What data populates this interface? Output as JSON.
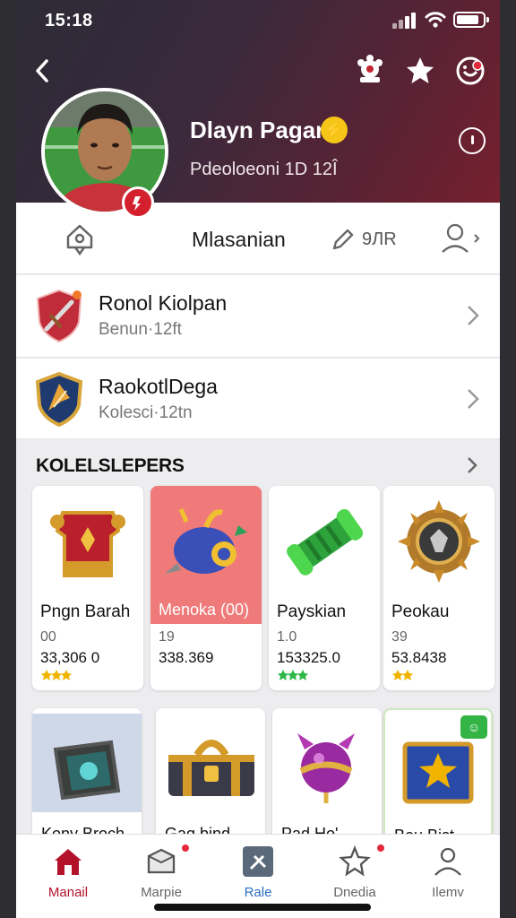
{
  "status": {
    "time": "15:18"
  },
  "profile": {
    "name": "Dlayn Pagan",
    "subtitle": "Pdeoloeoni 1D 12Î",
    "name_badge": "⚡"
  },
  "actions": {
    "title": "Mlasanian",
    "edit_label": "9ЛR"
  },
  "rows": [
    {
      "title": "Ronol Kiolpan",
      "subtitle": "Benun·12ft"
    },
    {
      "title": "RaokotlDega",
      "subtitle": "Kolesci·12tn"
    }
  ],
  "collection": {
    "title": "KOLELSLEPERS",
    "items": [
      {
        "name": "Pngn Barah",
        "level": "00",
        "price": "33,306 0",
        "star_color": "#f0b400"
      },
      {
        "name": "Menoka (00)",
        "level": "19",
        "price": "338.369",
        "star_color": "#f0b400"
      },
      {
        "name": "Payskian",
        "level": "1.0",
        "price": "153325.0",
        "star_color": "#2fb84a"
      },
      {
        "name": "Peokau",
        "level": "39",
        "price": "53.8438",
        "star_color": "#f0b400"
      }
    ],
    "items_row2": [
      {
        "name": "Kony Broch"
      },
      {
        "name": "Gaq bind"
      },
      {
        "name": "Pad Ho'"
      },
      {
        "name": "Bou Bist",
        "badge": "☺"
      }
    ]
  },
  "tabs": [
    {
      "label": "Manail",
      "icon": "home-icon"
    },
    {
      "label": "Marpie",
      "icon": "box-icon"
    },
    {
      "label": "Rale",
      "icon": "tool-icon"
    },
    {
      "label": "Dnedia",
      "icon": "star-icon"
    },
    {
      "label": "Ilemv",
      "icon": "user-icon"
    }
  ],
  "colors": {
    "accent": "#b3132a",
    "header_start": "#2b2b35",
    "header_end": "#7a1f2d"
  }
}
